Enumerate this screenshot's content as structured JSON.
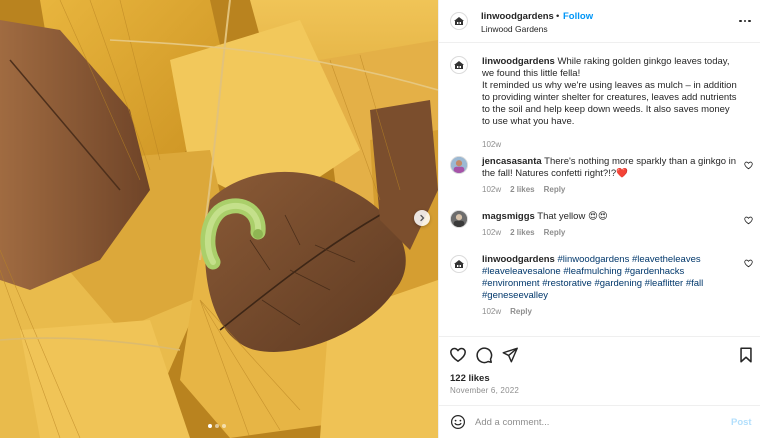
{
  "account": {
    "username": "linwoodgardens",
    "follow_label": "Follow",
    "location": "Linwood Gardens",
    "separator": "•"
  },
  "caption": {
    "username": "linwoodgardens",
    "text": "While raking golden ginkgo leaves today, we found this little fella!\nIt reminded us why we're using leaves as mulch – in addition to providing winter shelter for creatures, leaves add nutrients to the soil and help keep down weeds. It also saves money to use what you have.",
    "time": "102w"
  },
  "comments": [
    {
      "username": "jencasasanta",
      "text": "There's nothing more sparkly than a ginkgo in the fall! Natures confetti right?!?❤️",
      "time": "102w",
      "likes": "2 likes",
      "reply": "Reply"
    },
    {
      "username": "magsmiggs",
      "text": "That yellow 😍😍",
      "time": "102w",
      "likes": "2 likes",
      "reply": "Reply"
    },
    {
      "username": "linwoodgardens",
      "text": "#linwoodgardens #leavetheleaves #leaveleavesalone #leafmulching #gardenhacks #environment #restorative #gardening #leaflitter #fall #geneseevalley",
      "time": "102w",
      "reply": "Reply"
    }
  ],
  "post_stats": {
    "likes": "122 likes",
    "date": "November 6, 2022"
  },
  "comment_box": {
    "placeholder": "Add a comment...",
    "post_label": "Post"
  },
  "carousel": {
    "slide_count": 3,
    "active_index": 0
  },
  "icons": [
    "more-icon",
    "heart-icon",
    "comment-icon",
    "share-icon",
    "bookmark-icon",
    "emoji-icon",
    "chevron-right-icon"
  ],
  "colors": {
    "follow": "#0095f6",
    "post_disabled": "#b2dffc",
    "heart_red": "#ed4956",
    "muted": "#8e8e8e"
  }
}
